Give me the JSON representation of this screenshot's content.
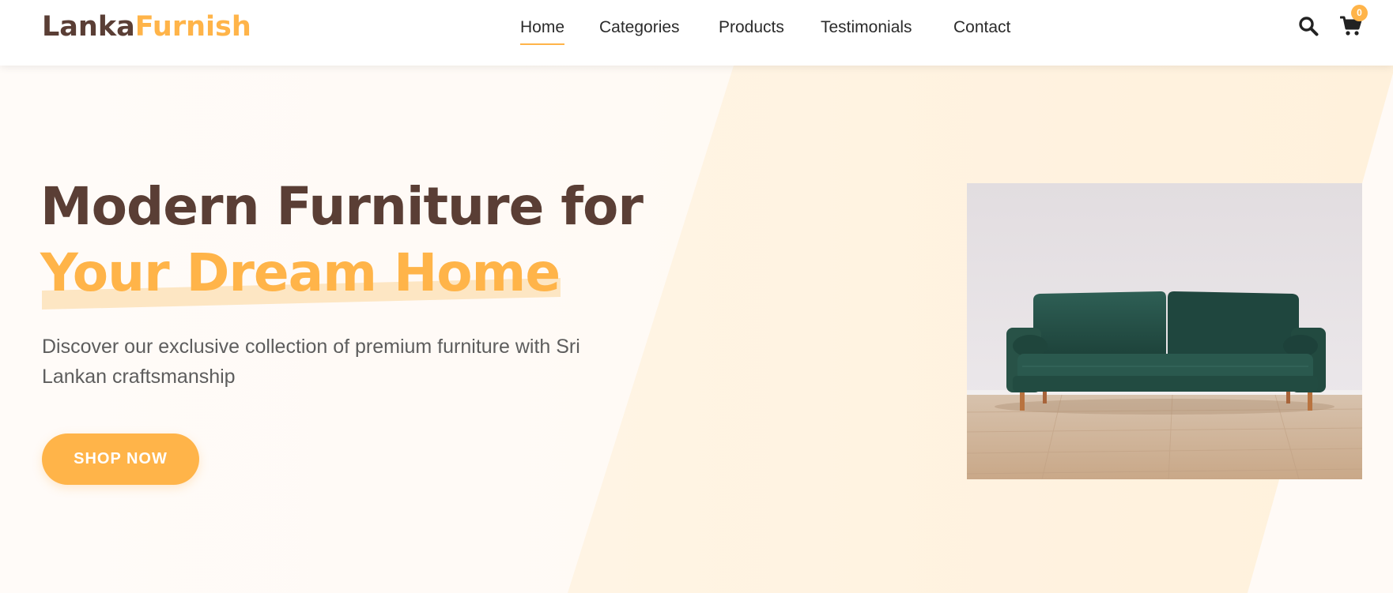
{
  "brand": {
    "part1": "Lanka",
    "part2": "Furnish"
  },
  "nav": {
    "items": [
      {
        "label": "Home",
        "active": true
      },
      {
        "label": "Categories",
        "active": false
      },
      {
        "label": "Products",
        "active": false
      },
      {
        "label": "Testimonials",
        "active": false
      },
      {
        "label": "Contact",
        "active": false
      }
    ]
  },
  "header_icons": {
    "search": "search-icon",
    "cart": "cart-icon",
    "cart_count": "0"
  },
  "hero": {
    "headline_line1": "Modern Furniture for",
    "headline_line2": "Your Dream Home",
    "subtitle": "Discover our exclusive collection of premium furniture with Sri Lankan craftsmanship",
    "cta_label": "SHOP NOW",
    "image_subject": "green velvet sofa"
  },
  "colors": {
    "brand_dark": "#5a3e35",
    "accent": "#ffb449",
    "accent_light": "#fde6c3",
    "text_muted": "#5d5d5d"
  }
}
